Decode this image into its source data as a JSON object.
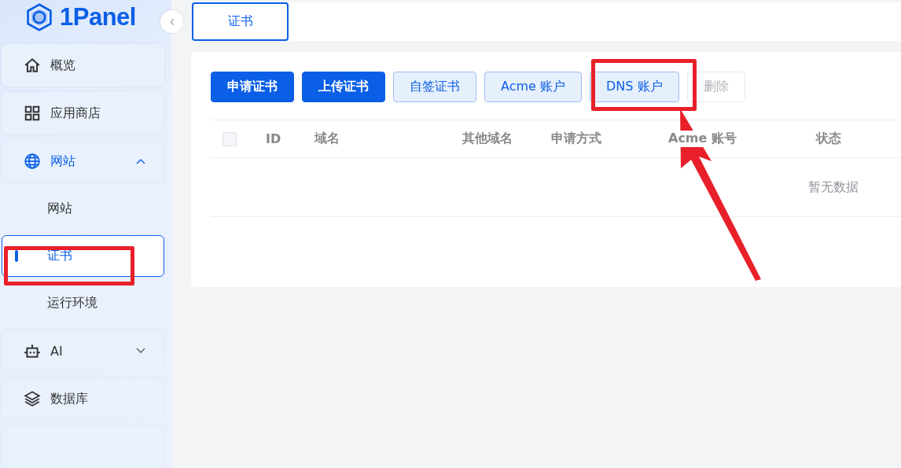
{
  "logo": {
    "text": "1Panel"
  },
  "sidebar": {
    "items": [
      {
        "label": "概览",
        "kind": "link",
        "expanded": false
      },
      {
        "label": "应用商店",
        "kind": "link",
        "expanded": false
      },
      {
        "label": "网站",
        "kind": "group",
        "expanded": true,
        "children": [
          {
            "label": "网站",
            "selected": false
          },
          {
            "label": "证书",
            "selected": true
          },
          {
            "label": "运行环境",
            "selected": false
          }
        ]
      },
      {
        "label": "AI",
        "kind": "group",
        "expanded": false
      },
      {
        "label": "数据库",
        "kind": "link",
        "expanded": false
      }
    ]
  },
  "tabs": [
    {
      "label": "证书",
      "selected": true
    }
  ],
  "toolbar": {
    "buttons": [
      {
        "label": "申请证书",
        "kind": "primary",
        "disabled": false
      },
      {
        "label": "上传证书",
        "kind": "primary",
        "disabled": false
      },
      {
        "label": "自签证书",
        "kind": "plain",
        "disabled": false
      },
      {
        "label": "Acme 账户",
        "kind": "plain",
        "disabled": false
      },
      {
        "label": "DNS 账户",
        "kind": "plain",
        "disabled": false
      },
      {
        "label": "删除",
        "kind": "default",
        "disabled": true
      }
    ]
  },
  "table": {
    "select_all": {
      "checked": false
    },
    "columns": [
      "ID",
      "域名",
      "其他域名",
      "申请方式",
      "Acme 账号",
      "状态"
    ],
    "empty_text": "暂无数据"
  }
}
